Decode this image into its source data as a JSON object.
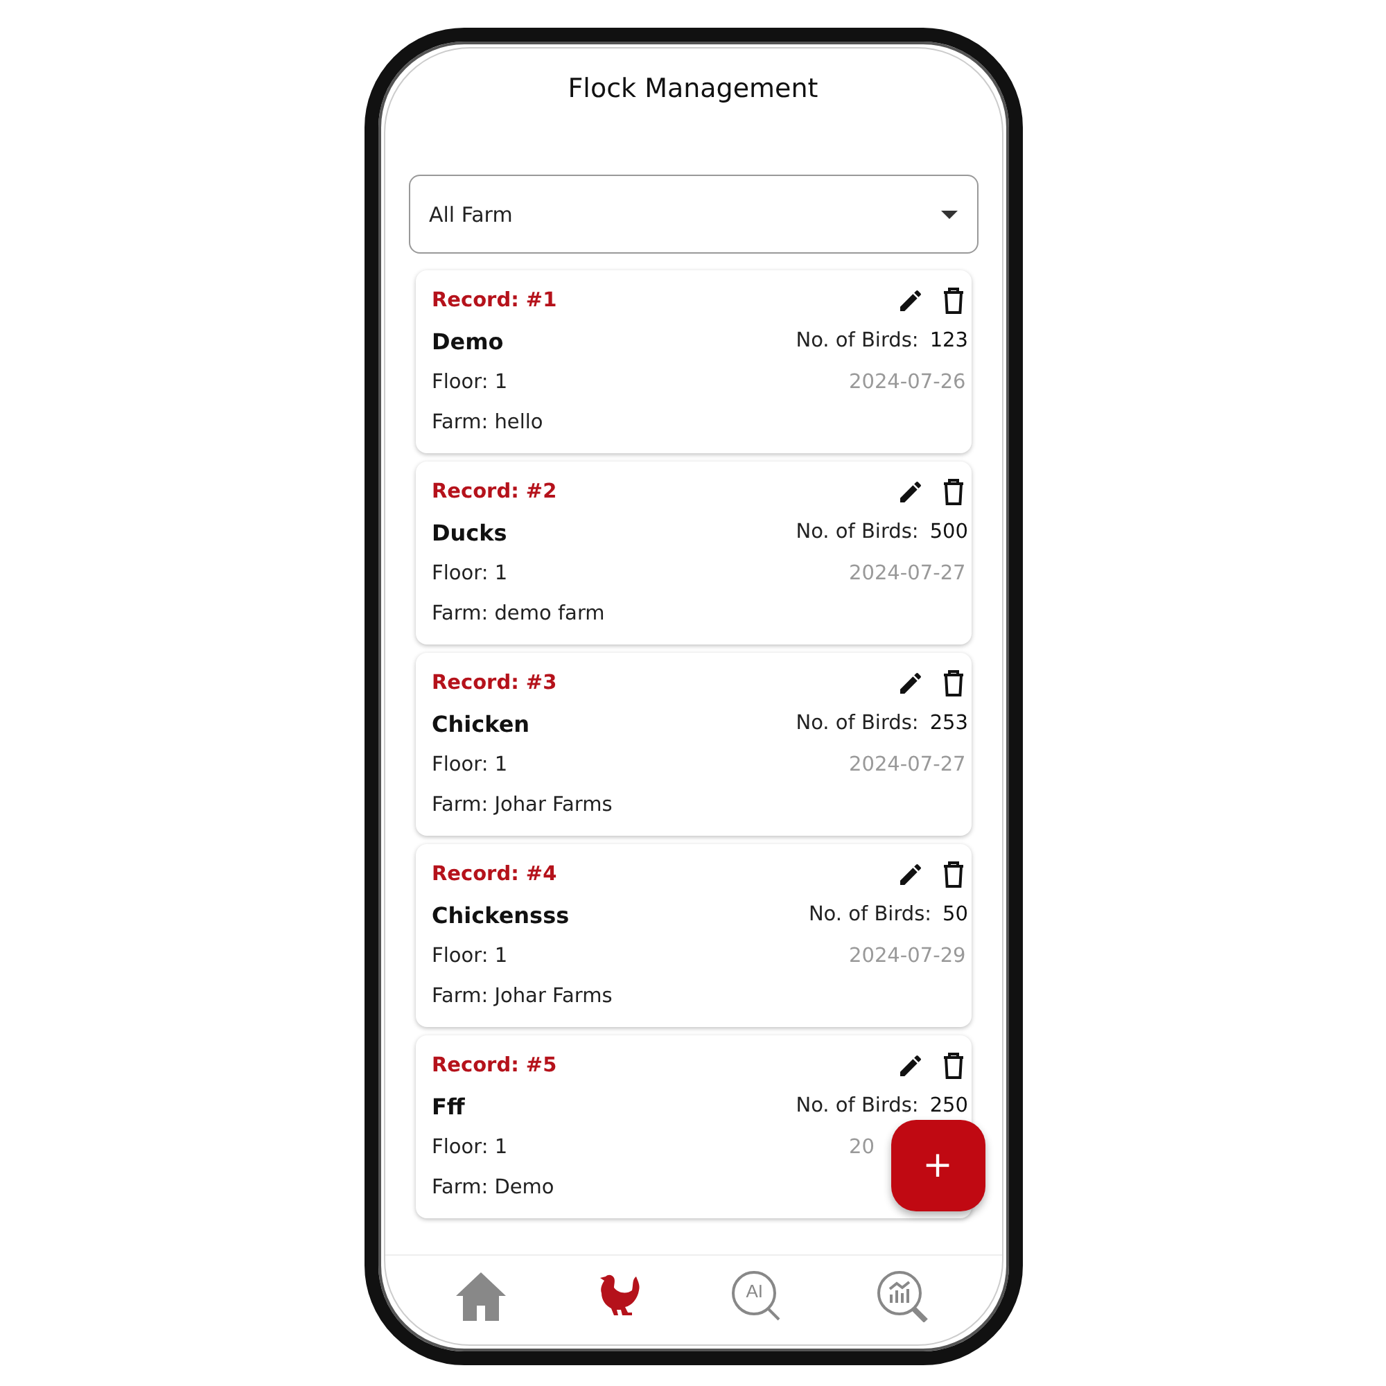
{
  "title": "Flock Management",
  "farm_filter": {
    "value": "All Farm"
  },
  "records": [
    {
      "record": "Record: #1",
      "name": "Demo",
      "birds_label": "No. of Birds:",
      "birds": "123",
      "floor": "Floor: 1",
      "date": "2024-07-26",
      "farm": "Farm: hello"
    },
    {
      "record": "Record: #2",
      "name": "Ducks",
      "birds_label": "No. of Birds:",
      "birds": "500",
      "floor": "Floor: 1",
      "date": "2024-07-27",
      "farm": "Farm: demo farm"
    },
    {
      "record": "Record: #3",
      "name": "Chicken",
      "birds_label": "No. of Birds:",
      "birds": "253",
      "floor": "Floor: 1",
      "date": "2024-07-27",
      "farm": "Farm: Johar Farms"
    },
    {
      "record": "Record: #4",
      "name": "Chickensss",
      "birds_label": "No. of Birds:",
      "birds": "50",
      "floor": "Floor: 1",
      "date": "2024-07-29",
      "farm": "Farm: Johar Farms"
    },
    {
      "record": "Record: #5",
      "name": "Fff",
      "birds_label": "No. of Birds:",
      "birds": "250",
      "floor": "Floor: 1",
      "date": "20",
      "farm": "Farm: Demo"
    }
  ],
  "fab": {
    "label": "+"
  },
  "nav": [
    {
      "kind": "home",
      "selected": false
    },
    {
      "kind": "flock",
      "selected": true
    },
    {
      "kind": "ai",
      "text": "AI",
      "selected": false
    },
    {
      "kind": "analytics",
      "selected": false
    }
  ]
}
